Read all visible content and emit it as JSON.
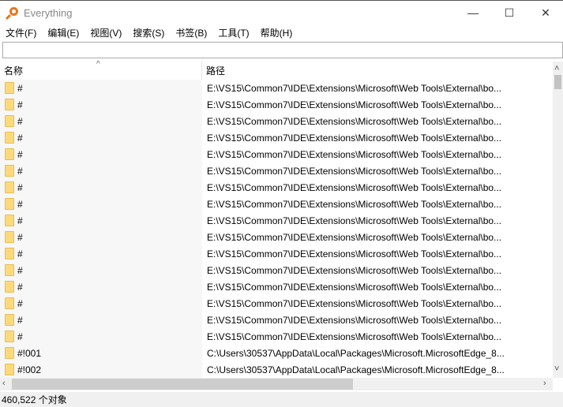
{
  "window": {
    "title": "Everything",
    "minimize": "—",
    "maximize": "☐",
    "close": "✕"
  },
  "menu": [
    "文件(F)",
    "编辑(E)",
    "视图(V)",
    "搜索(S)",
    "书签(B)",
    "工具(T)",
    "帮助(H)"
  ],
  "search": {
    "value": ""
  },
  "columns": {
    "name": "名称",
    "path": "路径"
  },
  "rows": [
    {
      "name": "#",
      "path": "E:\\VS15\\Common7\\IDE\\Extensions\\Microsoft\\Web Tools\\External\\bo..."
    },
    {
      "name": "#",
      "path": "E:\\VS15\\Common7\\IDE\\Extensions\\Microsoft\\Web Tools\\External\\bo..."
    },
    {
      "name": "#",
      "path": "E:\\VS15\\Common7\\IDE\\Extensions\\Microsoft\\Web Tools\\External\\bo..."
    },
    {
      "name": "#",
      "path": "E:\\VS15\\Common7\\IDE\\Extensions\\Microsoft\\Web Tools\\External\\bo..."
    },
    {
      "name": "#",
      "path": "E:\\VS15\\Common7\\IDE\\Extensions\\Microsoft\\Web Tools\\External\\bo..."
    },
    {
      "name": "#",
      "path": "E:\\VS15\\Common7\\IDE\\Extensions\\Microsoft\\Web Tools\\External\\bo..."
    },
    {
      "name": "#",
      "path": "E:\\VS15\\Common7\\IDE\\Extensions\\Microsoft\\Web Tools\\External\\bo..."
    },
    {
      "name": "#",
      "path": "E:\\VS15\\Common7\\IDE\\Extensions\\Microsoft\\Web Tools\\External\\bo..."
    },
    {
      "name": "#",
      "path": "E:\\VS15\\Common7\\IDE\\Extensions\\Microsoft\\Web Tools\\External\\bo..."
    },
    {
      "name": "#",
      "path": "E:\\VS15\\Common7\\IDE\\Extensions\\Microsoft\\Web Tools\\External\\bo..."
    },
    {
      "name": "#",
      "path": "E:\\VS15\\Common7\\IDE\\Extensions\\Microsoft\\Web Tools\\External\\bo..."
    },
    {
      "name": "#",
      "path": "E:\\VS15\\Common7\\IDE\\Extensions\\Microsoft\\Web Tools\\External\\bo..."
    },
    {
      "name": "#",
      "path": "E:\\VS15\\Common7\\IDE\\Extensions\\Microsoft\\Web Tools\\External\\bo..."
    },
    {
      "name": "#",
      "path": "E:\\VS15\\Common7\\IDE\\Extensions\\Microsoft\\Web Tools\\External\\bo..."
    },
    {
      "name": "#",
      "path": "E:\\VS15\\Common7\\IDE\\Extensions\\Microsoft\\Web Tools\\External\\bo..."
    },
    {
      "name": "#",
      "path": "E:\\VS15\\Common7\\IDE\\Extensions\\Microsoft\\Web Tools\\External\\bo..."
    },
    {
      "name": "#!001",
      "path": "C:\\Users\\30537\\AppData\\Local\\Packages\\Microsoft.MicrosoftEdge_8..."
    },
    {
      "name": "#!002",
      "path": "C:\\Users\\30537\\AppData\\Local\\Packages\\Microsoft.MicrosoftEdge_8..."
    }
  ],
  "status": "460,522 个对象"
}
